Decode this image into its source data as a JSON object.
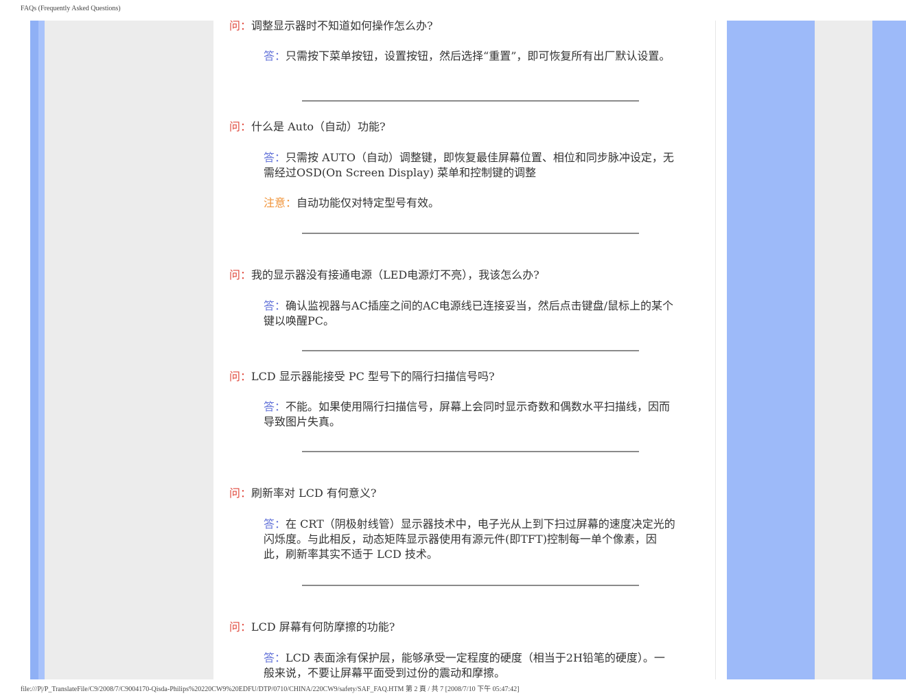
{
  "header": {
    "title": "FAQs (Frequently Asked Questions)"
  },
  "footer": {
    "path": "file:///P|/P_TranslateFile/C9/2008/7/C9004170-Qisda-Philips%20220CW9%20EDFU/DTP/0710/CHINA/220CW9/safety/SAF_FAQ.HTM 第 2 頁 / 共 7  [2008/7/10 下午 05:47:42]"
  },
  "colors": {
    "left_dark_blue": "#8fb0f5",
    "left_light_blue": "#a9c3fb",
    "left_gray": "#ececec",
    "right_blue": "#9dbaf9",
    "right_gray": "#ececec",
    "question_label": "#e0483c",
    "answer_label": "#6272d8",
    "note_label": "#f0943a",
    "divider": "#8a8a8a"
  },
  "labels": {
    "question": "问：",
    "answer": "答：",
    "note": "注意："
  },
  "faqs": [
    {
      "q": "调整显示器时不知道如何操作怎么办?",
      "a": "只需按下菜单按钮，设置按钮，然后选择“重置”，即可恢复所有出厂默认设置。"
    },
    {
      "q": "什么是 Auto（自动）功能?",
      "a": "只需按 AUTO（自动）调整键，即恢复最佳屏幕位置、相位和同步脉冲设定，无需经过OSD(On Screen Display) 菜单和控制键的调整",
      "note": "自动功能仅对特定型号有效。"
    },
    {
      "q": "我的显示器没有接通电源（LED电源灯不亮），我该怎么办?",
      "a": "确认监视器与AC插座之间的AC电源线已连接妥当，然后点击键盘/鼠标上的某个键以唤醒PC。"
    },
    {
      "q": "LCD 显示器能接受 PC 型号下的隔行扫描信号吗?",
      "a": "不能。如果使用隔行扫描信号，屏幕上会同时显示奇数和偶数水平扫描线，因而导致图片失真。"
    },
    {
      "q": "刷新率对 LCD 有何意义?",
      "a": "在 CRT（阴极射线管）显示器技术中，电子光从上到下扫过屏幕的速度决定光的闪烁度。与此相反，动态矩阵显示器使用有源元件(即TFT)控制每一单个像素，因此，刷新率其实不适于 LCD 技术。"
    },
    {
      "q": "LCD 屏幕有何防摩擦的功能?",
      "a": "LCD 表面涂有保护层，能够承受一定程度的硬度（相当于2H铅笔的硬度）。一般来说，不要让屏幕平面受到过份的震动和摩擦。"
    }
  ]
}
